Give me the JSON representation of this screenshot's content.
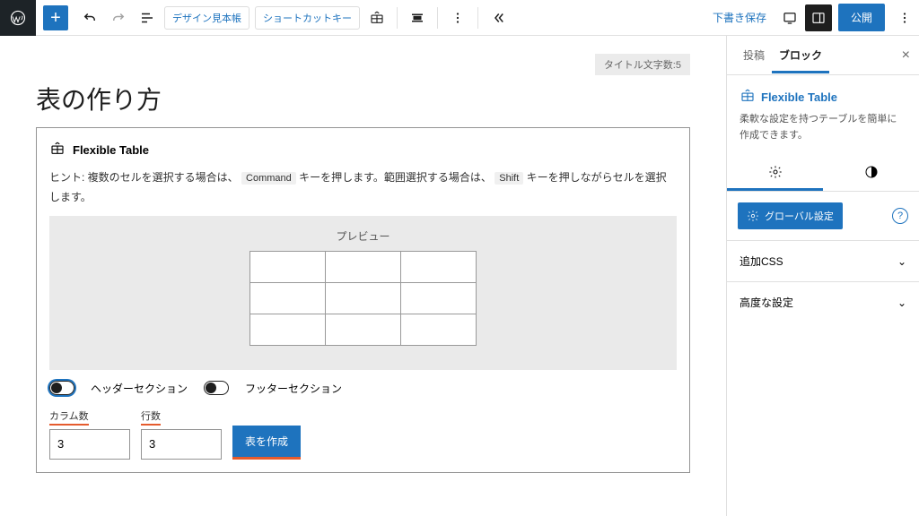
{
  "toolbar": {
    "link1": "デザイン見本帳",
    "link2": "ショートカットキー"
  },
  "header": {
    "draft": "下書き保存",
    "publish": "公開"
  },
  "editor": {
    "badge": "タイトル文字数:5",
    "title": "表の作り方",
    "block_name": "Flexible Table",
    "hint_prefix": "ヒント: 複数のセルを選択する場合は、",
    "kbd1": "Command",
    "hint_mid": "キーを押します。範囲選択する場合は、",
    "kbd2": "Shift",
    "hint_suffix": "キーを押しながらセルを選択します。",
    "preview_label": "プレビュー",
    "toggle_header": "ヘッダーセクション",
    "toggle_footer": "フッターセクション",
    "cols_label": "カラム数",
    "rows_label": "行数",
    "cols_value": "3",
    "rows_value": "3",
    "create": "表を作成"
  },
  "sidebar": {
    "tab_post": "投稿",
    "tab_block": "ブロック",
    "block_name": "Flexible Table",
    "block_desc": "柔軟な設定を持つテーブルを簡単に作成できます。",
    "global": "グローバル設定",
    "panel_css": "追加CSS",
    "panel_adv": "高度な設定"
  }
}
